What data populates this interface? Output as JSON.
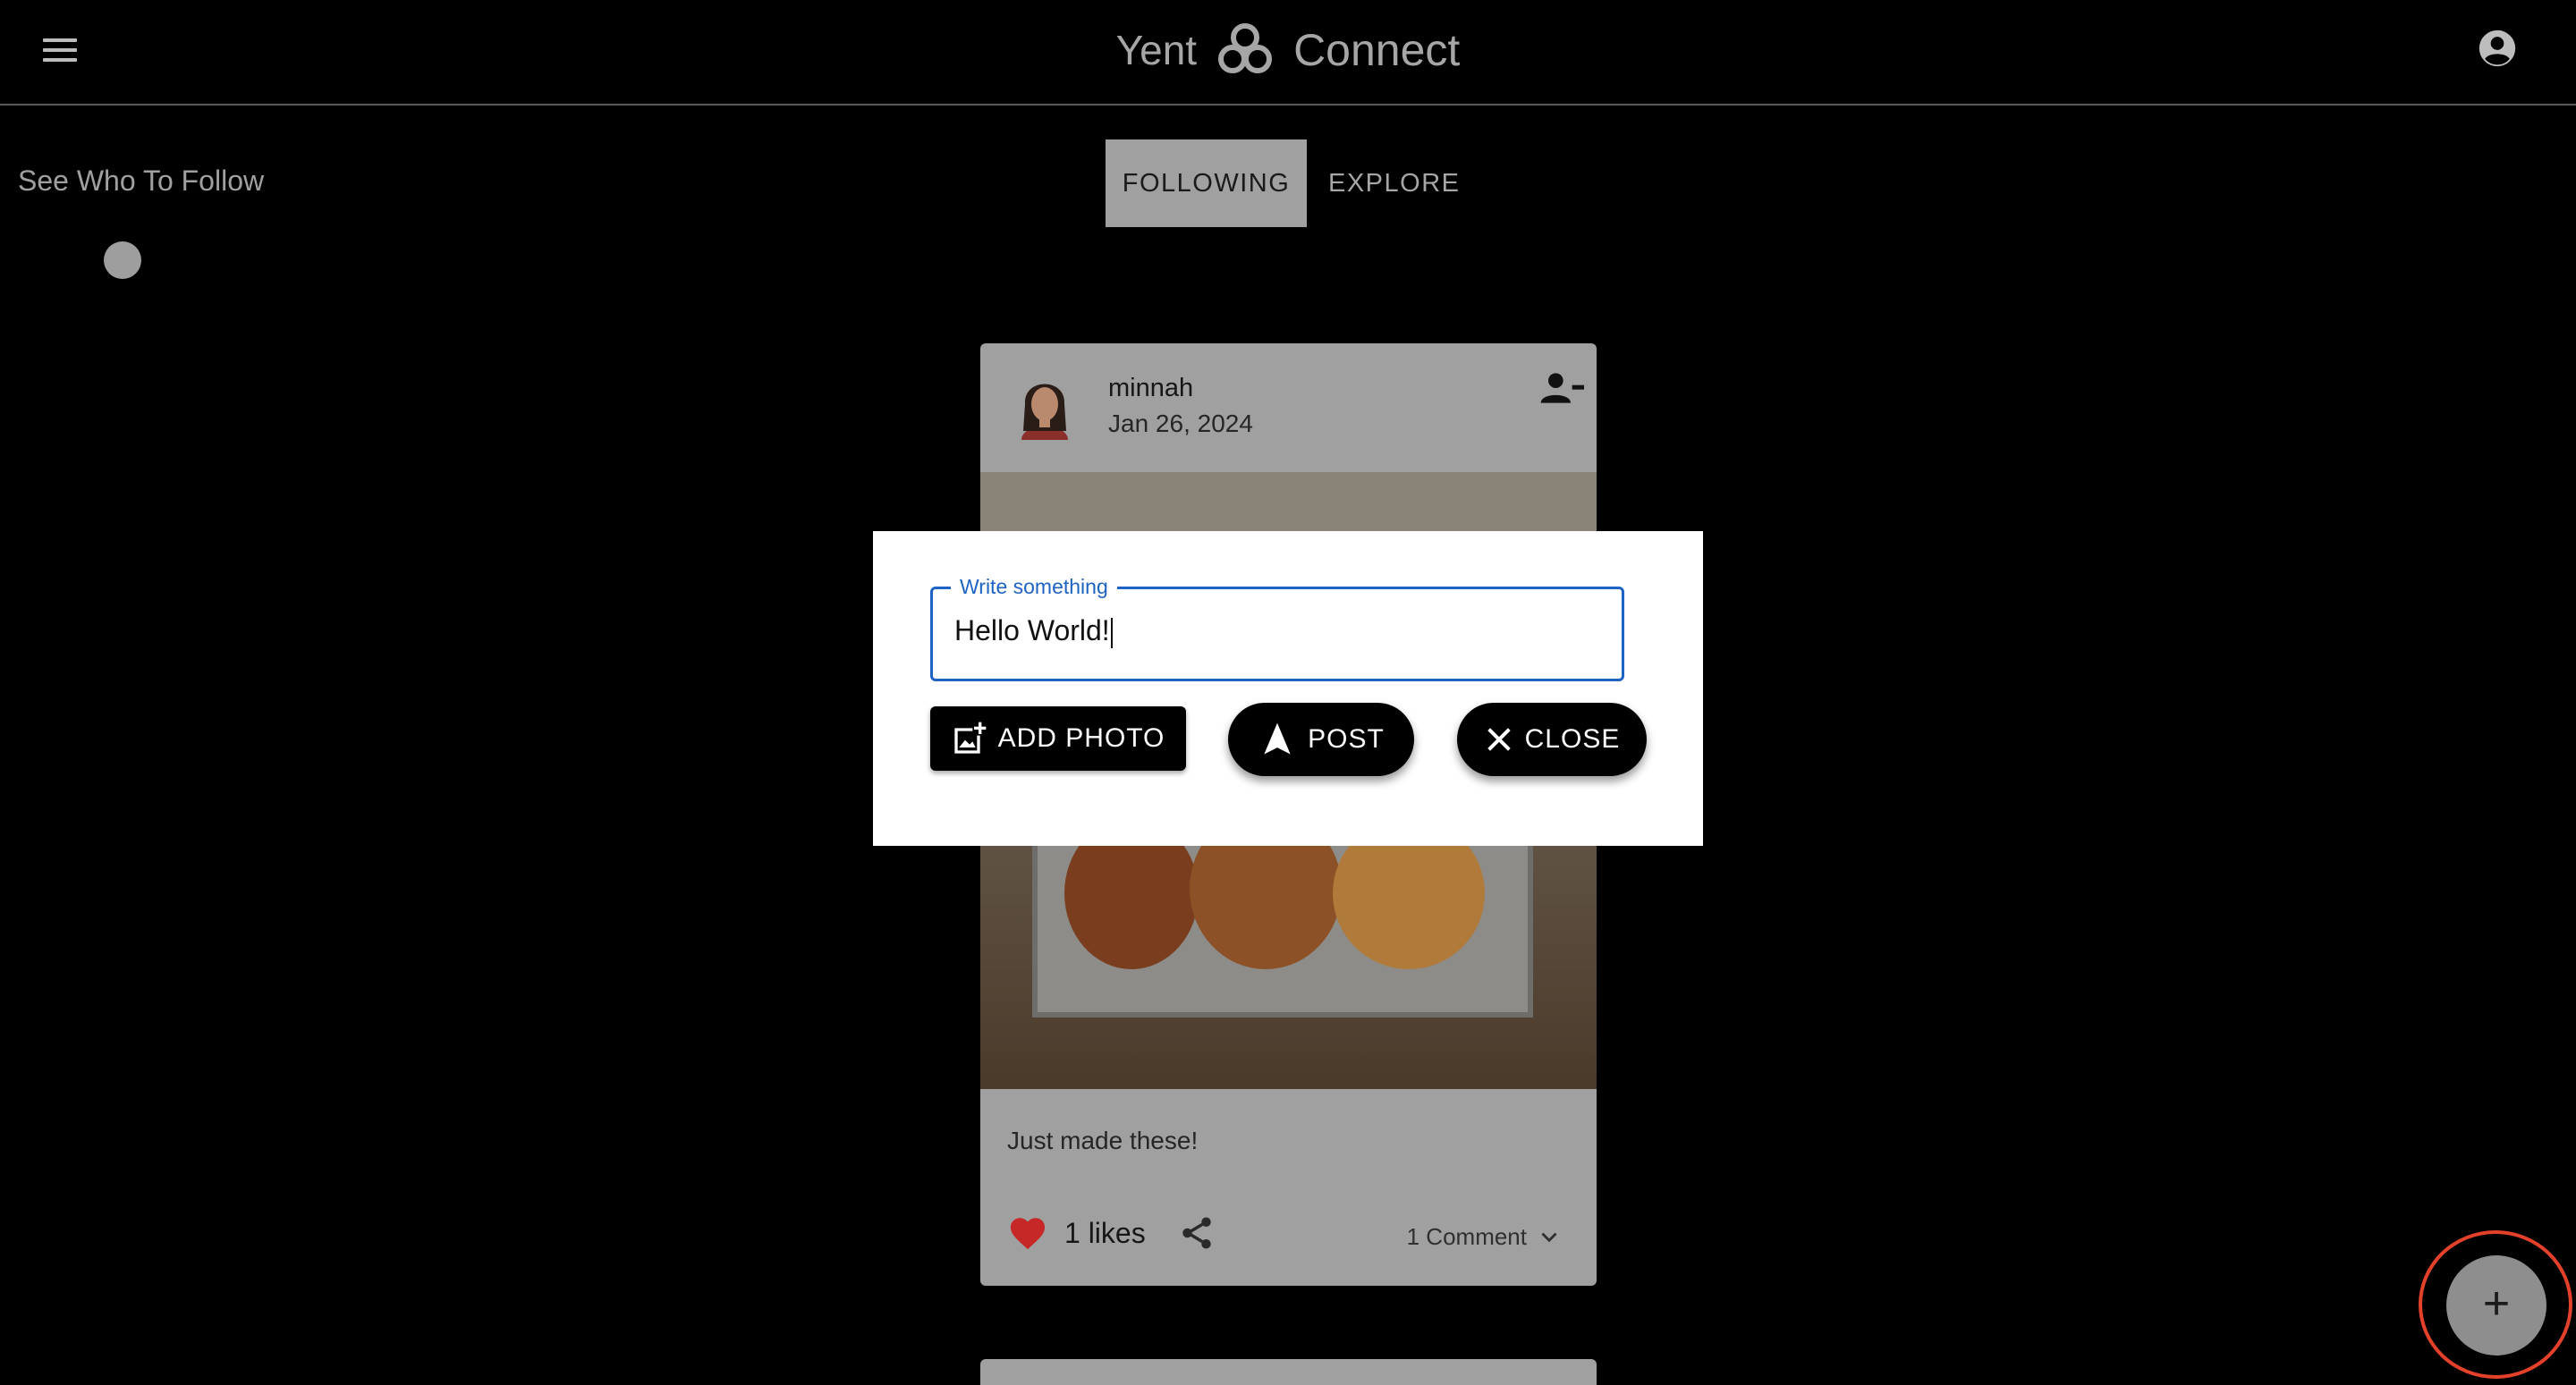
{
  "header": {
    "brand_left": "Yent",
    "brand_right": "Connect",
    "menu_icon": "hamburger-menu-icon",
    "account_icon": "account-circle-icon"
  },
  "sidebar": {
    "heading": "See Who To Follow"
  },
  "tabs": [
    {
      "label": "FOLLOWING",
      "active": true
    },
    {
      "label": "EXPLORE",
      "active": false
    }
  ],
  "post": {
    "username": "minnah",
    "date": "Jan 26, 2024",
    "text": "Just made these!",
    "likes_label": "1 likes",
    "comments_label": "1 Comment",
    "liked": true
  },
  "dialog": {
    "field_label": "Write something",
    "field_value": "Hello World!",
    "add_photo_label": "ADD PHOTO",
    "post_label": "POST",
    "close_label": "CLOSE"
  },
  "fab": {
    "label": "+"
  },
  "colors": {
    "accent_blue": "#1e63c2",
    "like_red": "#d32f2f",
    "highlight_ring": "#e4412a"
  }
}
